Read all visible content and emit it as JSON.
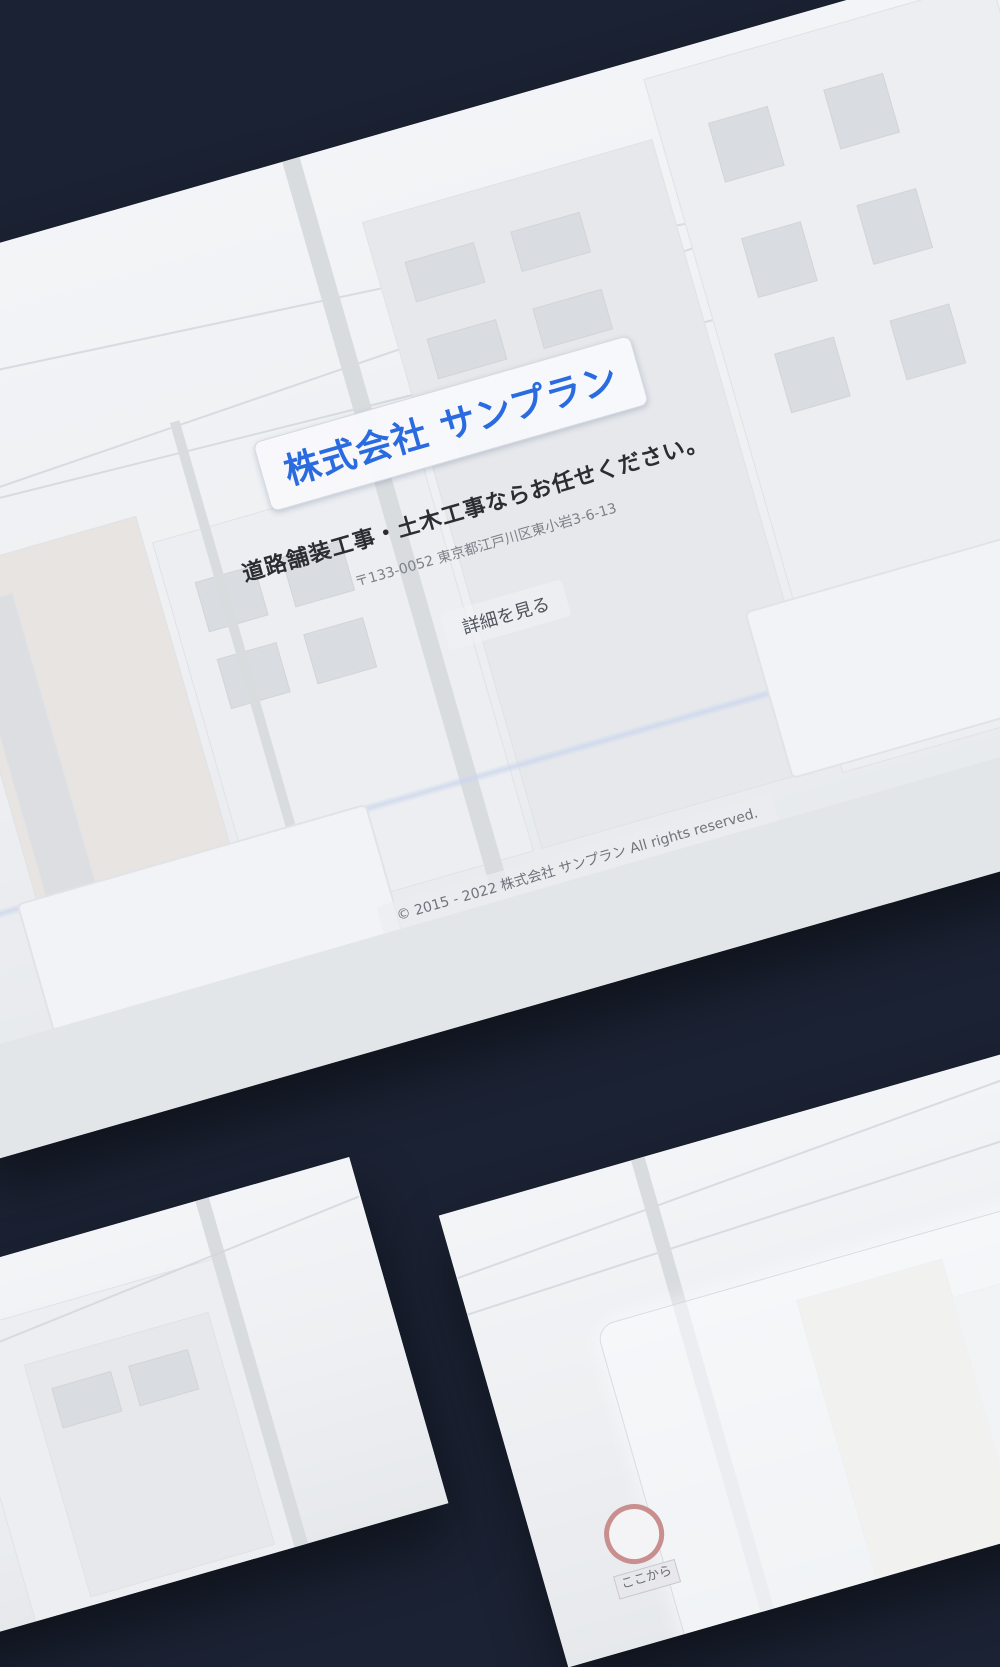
{
  "hero": {
    "logo_text": "株式会社 サンプラン",
    "tagline": "道路舗装工事・土木工事ならお任せください。",
    "address": "〒133-0052 東京都江戸川区東小岩3-6-13",
    "details_button_label": "詳細を見る"
  },
  "footer": {
    "copyright": "© 2015 - 2022 株式会社 サンプラン All rights reserved."
  },
  "bottom_card": {
    "sign_label": "ここから"
  }
}
